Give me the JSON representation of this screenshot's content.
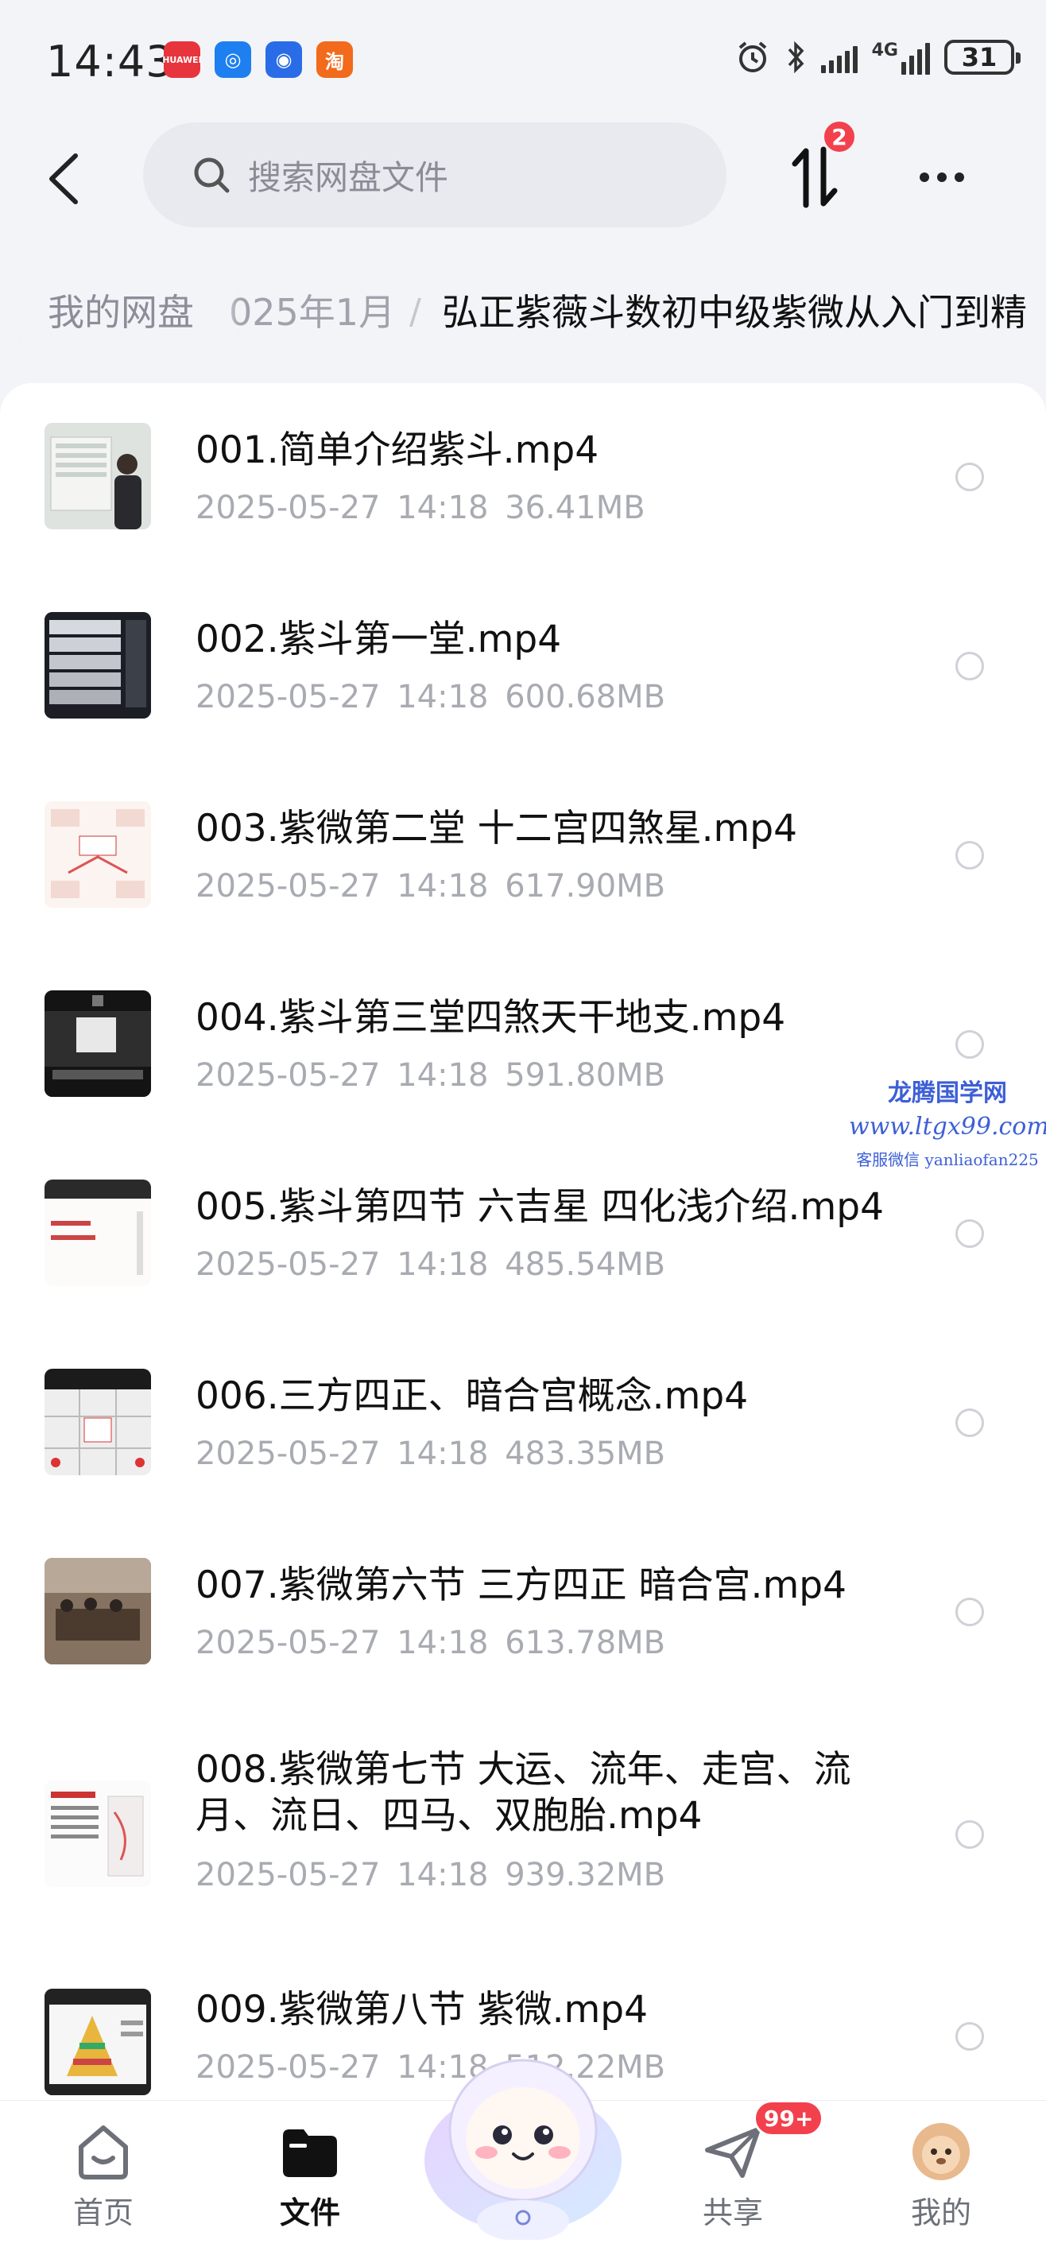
{
  "status_bar": {
    "time": "14:43",
    "app_icons": [
      {
        "name": "huawei-app-icon",
        "glyph": "HUAWEI",
        "color": "#e8343c"
      },
      {
        "name": "blue-app-icon",
        "glyph": "◎",
        "color": "#1e7ff0"
      },
      {
        "name": "browser-app-icon",
        "glyph": "◉",
        "color": "#2a6ce8"
      },
      {
        "name": "taobao-app-icon",
        "glyph": "淘",
        "color": "#f26a1b"
      }
    ],
    "network": "4G",
    "battery": "31"
  },
  "header": {
    "search_placeholder": "搜索网盘文件",
    "transfer_badge": "2"
  },
  "breadcrumb": {
    "root": "我的网盘",
    "middle": "025年1月",
    "separator": "/",
    "current": "弘正紫薇斗数初中级紫微从入门到精"
  },
  "files": [
    {
      "name": "001.简单介绍紫斗.mp4",
      "date": "2025-05-27",
      "time": "14:18",
      "size": "36.41MB"
    },
    {
      "name": "002.紫斗第一堂.mp4",
      "date": "2025-05-27",
      "time": "14:18",
      "size": "600.68MB"
    },
    {
      "name": "003.紫微第二堂 十二宫四煞星.mp4",
      "date": "2025-05-27",
      "time": "14:18",
      "size": "617.90MB"
    },
    {
      "name": "004.紫斗第三堂四煞天干地支.mp4",
      "date": "2025-05-27",
      "time": "14:18",
      "size": "591.80MB"
    },
    {
      "name": "005.紫斗第四节 六吉星 四化浅介绍.mp4",
      "date": "2025-05-27",
      "time": "14:18",
      "size": "485.54MB"
    },
    {
      "name": "006.三方四正、暗合宫概念.mp4",
      "date": "2025-05-27",
      "time": "14:18",
      "size": "483.35MB"
    },
    {
      "name": "007.紫微第六节 三方四正 暗合宫.mp4",
      "date": "2025-05-27",
      "time": "14:18",
      "size": "613.78MB"
    },
    {
      "name": "008.紫微第七节 大运、流年、走宫、流月、流日、四马、双胞胎.mp4",
      "date": "2025-05-27",
      "time": "14:18",
      "size": "939.32MB"
    },
    {
      "name": "009.紫微第八节 紫微.mp4",
      "date": "2025-05-27",
      "time": "14:18",
      "size": "512.22MB"
    }
  ],
  "watermark": {
    "line1": "龙腾国学网",
    "line2": "www.ltgx99.com",
    "line3": "客服微信 yanliaofan225"
  },
  "bottom_nav": {
    "home": "首页",
    "files": "文件",
    "share": "共享",
    "mine": "我的",
    "share_badge": "99+"
  }
}
